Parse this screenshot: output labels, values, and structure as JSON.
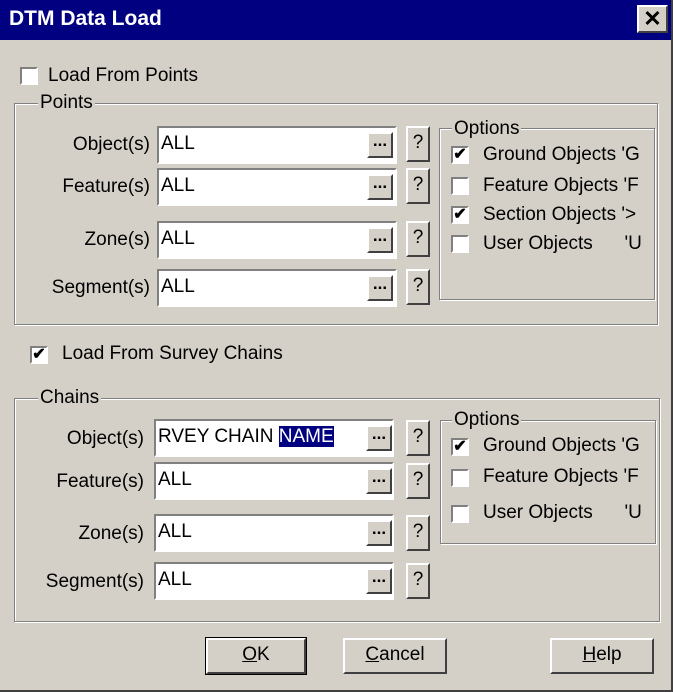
{
  "window": {
    "title": "DTM Data Load",
    "close_glyph": "✕"
  },
  "load_from_points": {
    "label": "Load From Points",
    "checked": false
  },
  "points": {
    "group_title": "Points",
    "rows": [
      {
        "label": "Object(s)",
        "value": "ALL"
      },
      {
        "label": "Feature(s)",
        "value": "ALL"
      },
      {
        "label": "Zone(s)",
        "value": "ALL"
      },
      {
        "label": "Segment(s)",
        "value": "ALL"
      }
    ],
    "options": {
      "title": "Options",
      "items": [
        {
          "label": "Ground Objects 'G",
          "checked": true
        },
        {
          "label": "Feature Objects 'F",
          "checked": false
        },
        {
          "label": "Section Objects '>",
          "checked": true
        },
        {
          "label": "User Objects      'U",
          "checked": false
        }
      ]
    }
  },
  "load_from_chains": {
    "label": "Load From Survey Chains",
    "checked": true
  },
  "chains": {
    "group_title": "Chains",
    "rows": [
      {
        "label": "Object(s)",
        "value_prefix": "RVEY CHAIN ",
        "value_selected": "NAME"
      },
      {
        "label": "Feature(s)",
        "value": "ALL"
      },
      {
        "label": "Zone(s)",
        "value": "ALL"
      },
      {
        "label": "Segment(s)",
        "value": "ALL"
      }
    ],
    "options": {
      "title": "Options",
      "items": [
        {
          "label": "Ground Objects 'G",
          "checked": true
        },
        {
          "label": "Feature Objects 'F",
          "checked": false
        },
        {
          "label": "User Objects      'U",
          "checked": false
        }
      ]
    }
  },
  "buttons": {
    "ellipsis": "...",
    "help_q": "?",
    "ok_mnemonic": "O",
    "ok_rest": "K",
    "cancel_mnemonic": "C",
    "cancel_rest": "ancel",
    "help_mnemonic": "H",
    "help_rest": "elp"
  },
  "check_glyph": "✔"
}
